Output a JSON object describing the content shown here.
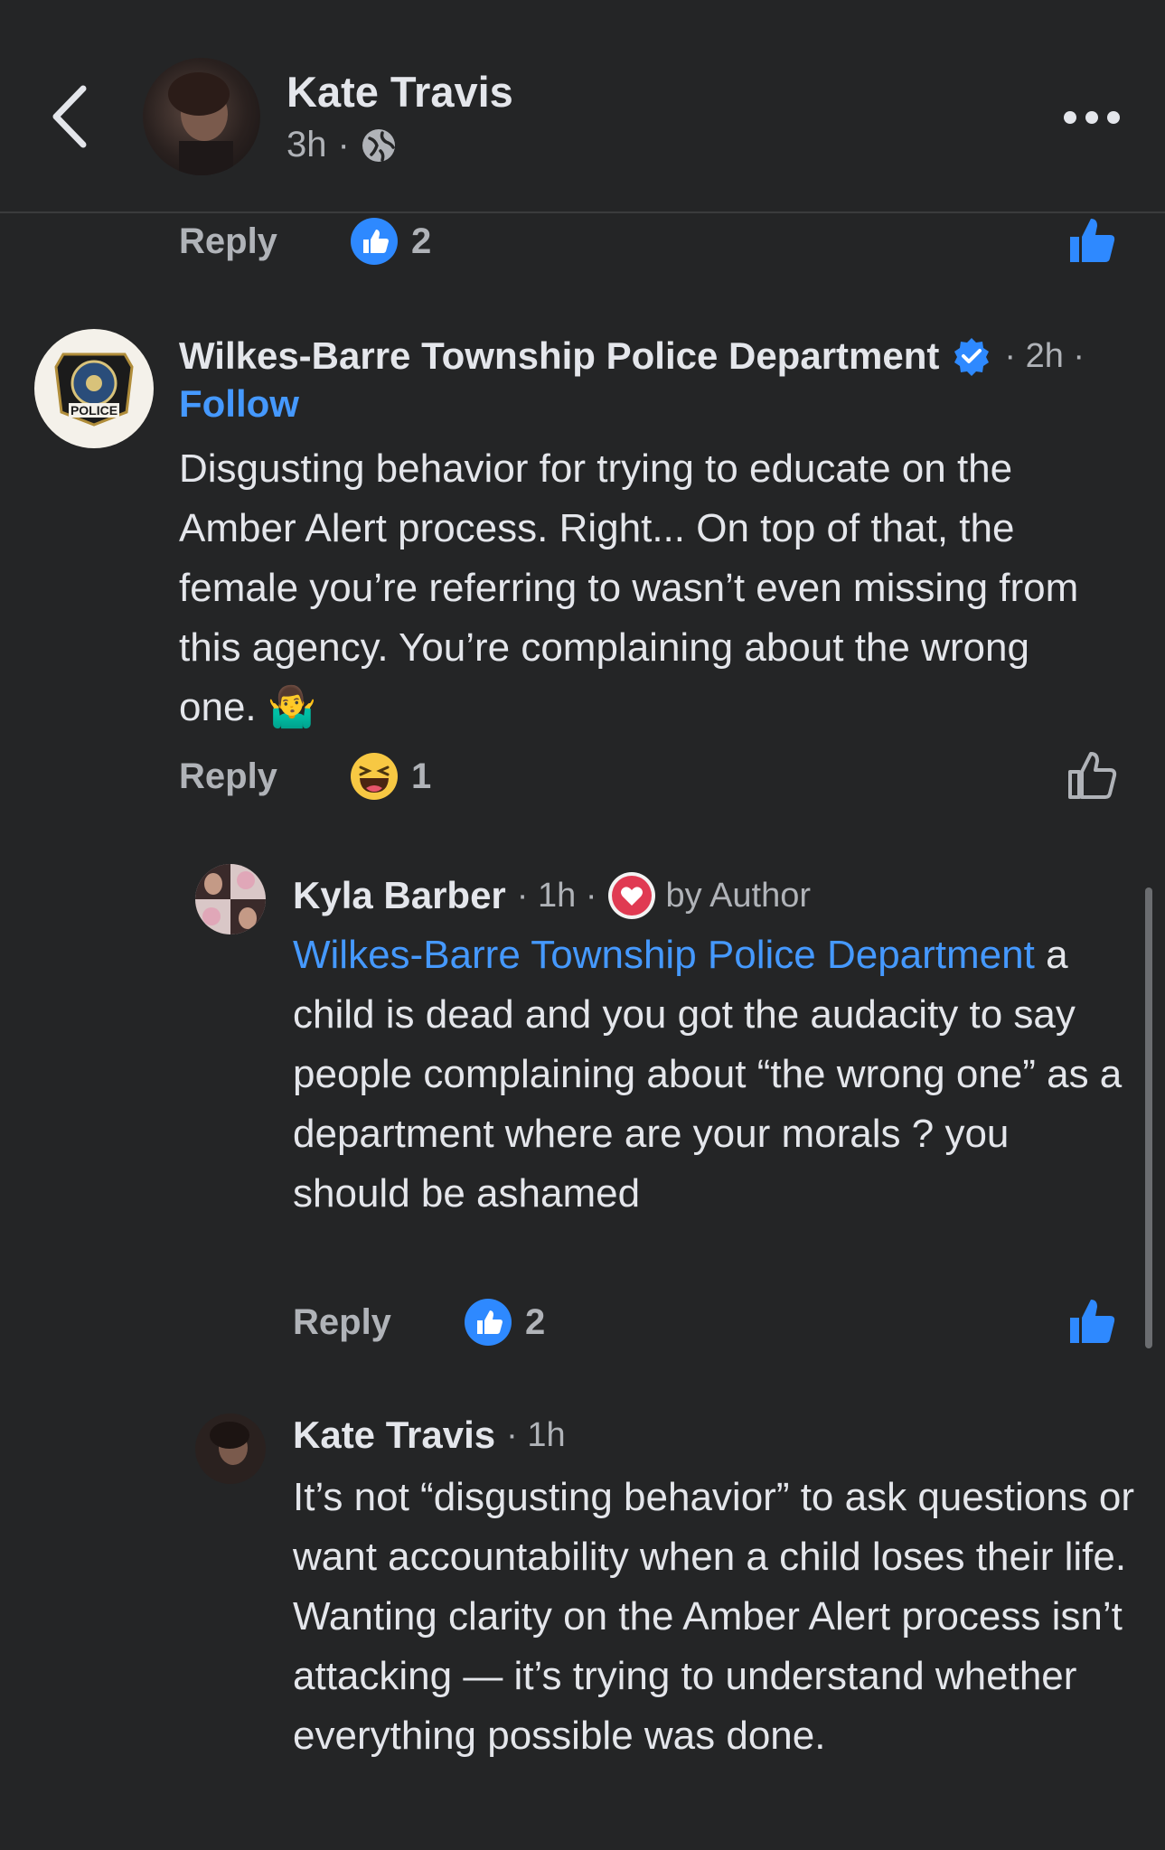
{
  "header": {
    "name": "Kate Travis",
    "time": "3h",
    "separator": "·"
  },
  "top_actions": {
    "reply_label": "Reply",
    "like_count": "2"
  },
  "comment_police": {
    "author": "Wilkes-Barre Township Police Department",
    "time": "· 2h ·",
    "follow_label": "Follow",
    "text": "Disgusting behavior for trying to educate on the Amber Alert process. Right... On top of that, the female you’re referring to wasn’t even missing from this agency. You’re complaining about the wrong one.",
    "emoji": "🤷‍♂️",
    "reply_label": "Reply",
    "reaction_count": "1",
    "logo_text": "POLICE"
  },
  "reply_kyla": {
    "author": "Kyla Barber",
    "time": "· 1h ·",
    "badge_label": "by Author",
    "mention": "Wilkes-Barre Township Police Department",
    "text": " a child is dead and you got the audacity to say people complaining about “the wrong one” as a department where are your morals ? you should be ashamed",
    "reply_label": "Reply",
    "like_count": "2"
  },
  "reply_kate": {
    "author": "Kate Travis",
    "time": "· 1h",
    "text": "It’s not “disgusting behavior” to ask questions or want accountability when a child loses their life. Wanting clarity on the Amber Alert process isn’t attacking — it’s trying to understand whether everything possible was done."
  },
  "colors": {
    "background": "#242526",
    "text_primary": "#e4e6eb",
    "text_secondary": "#b0b3b8",
    "link_blue": "#4599ff",
    "like_blue": "#2e89ff"
  },
  "icons": [
    "back-chevron-icon",
    "globe-icon",
    "more-dots-icon",
    "like-badge-icon",
    "like-icon",
    "verified-badge-icon",
    "haha-reaction-icon",
    "heart-badge-icon"
  ]
}
